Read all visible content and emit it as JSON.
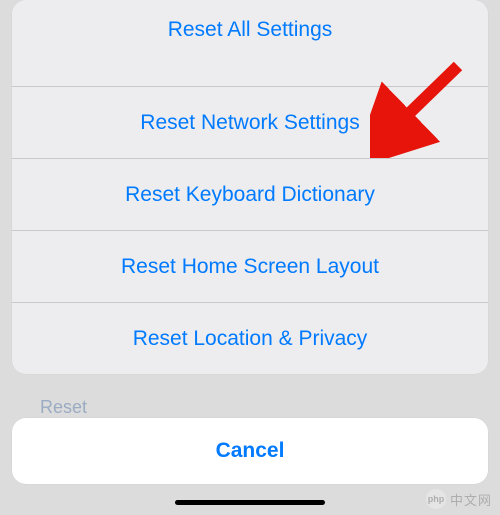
{
  "sheet": {
    "items": [
      "Reset All Settings",
      "Reset Network Settings",
      "Reset Keyboard Dictionary",
      "Reset Home Screen Layout",
      "Reset Location & Privacy"
    ],
    "cancel": "Cancel"
  },
  "background": {
    "ghost_label": "Reset"
  },
  "watermark": {
    "logo": "php",
    "text": "中文网"
  },
  "annotation": {
    "arrow_color": "#e6140a"
  }
}
